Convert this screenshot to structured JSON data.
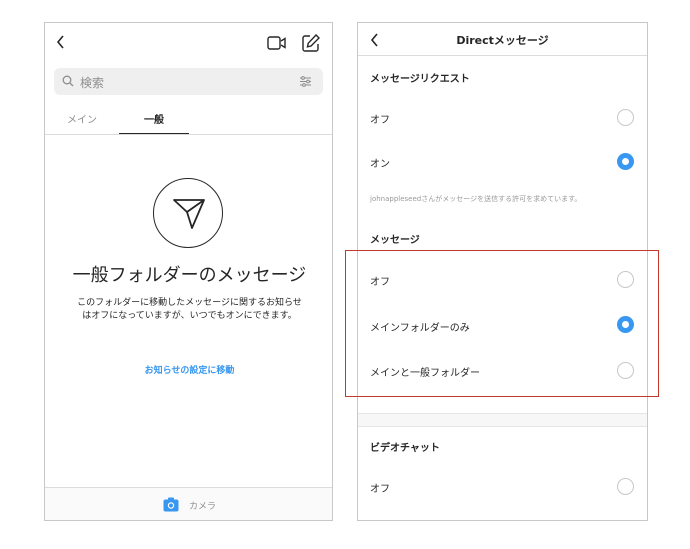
{
  "left": {
    "search": {
      "placeholder": "検索"
    },
    "tabs": [
      {
        "label": "メイン"
      },
      {
        "label": "一般"
      }
    ],
    "empty_state": {
      "title": "一般フォルダーのメッセージ",
      "description": "このフォルダーに移動したメッセージに関するお知らせはオフになっていますが、いつでもオンにできます。",
      "link": "お知らせの設定に移動"
    },
    "bottom": {
      "camera_label": "カメラ"
    }
  },
  "right": {
    "title": "Directメッセージ",
    "sections": [
      {
        "title": "メッセージリクエスト",
        "options": [
          {
            "label": "オフ",
            "selected": false
          },
          {
            "label": "オン",
            "selected": true
          }
        ],
        "note": "johnappleseedさんがメッセージを送信する許可を求めています。"
      },
      {
        "title": "メッセージ",
        "options": [
          {
            "label": "オフ",
            "selected": false
          },
          {
            "label": "メインフォルダーのみ",
            "selected": true
          },
          {
            "label": "メインと一般フォルダー",
            "selected": false
          }
        ]
      },
      {
        "title": "ビデオチャット",
        "options": [
          {
            "label": "オフ",
            "selected": false
          }
        ]
      }
    ]
  },
  "colors": {
    "accent": "#3897f0",
    "highlight": "#c0392b",
    "text": "#262626",
    "muted": "#8e8e8e"
  }
}
